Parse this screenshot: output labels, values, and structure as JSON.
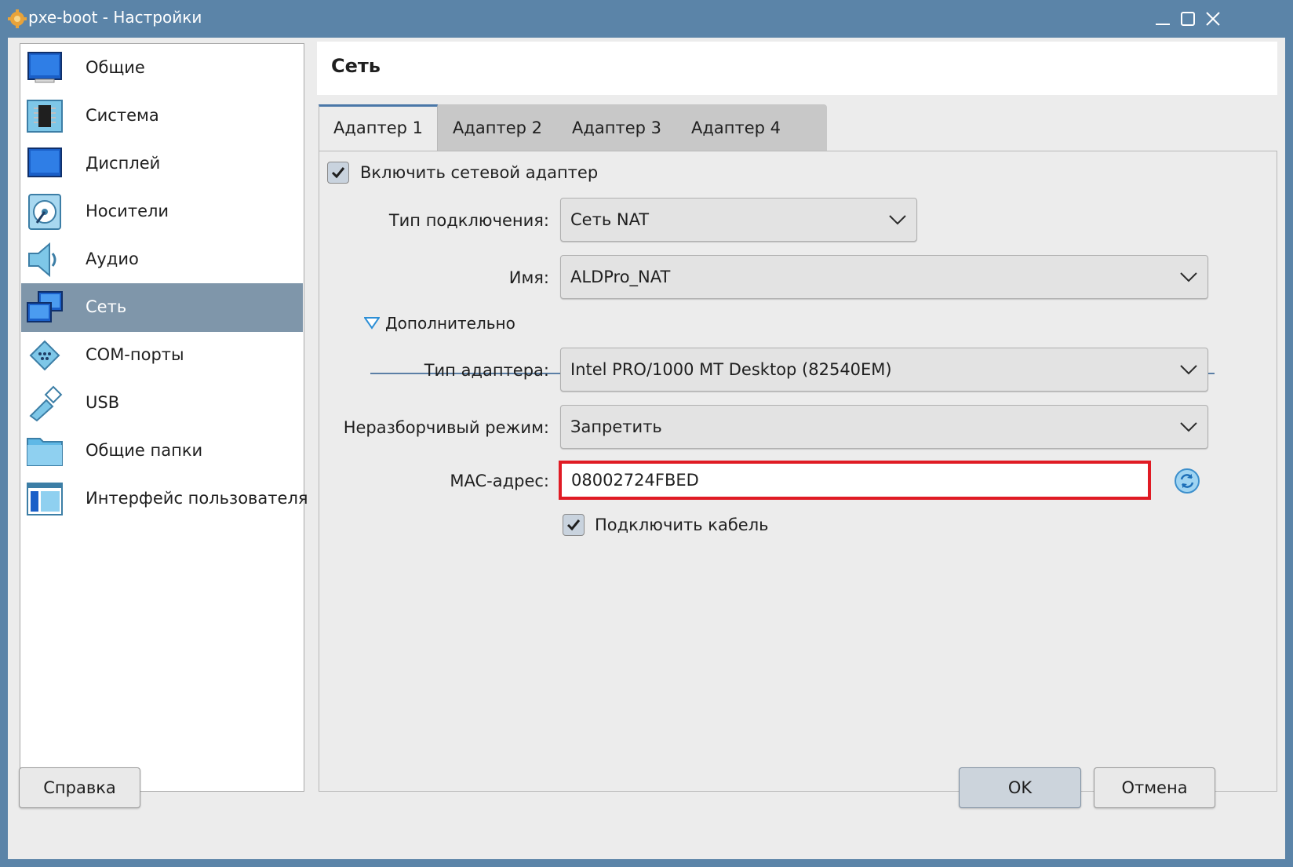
{
  "window": {
    "title": "pxe-boot - Настройки"
  },
  "sidebar": {
    "items": [
      {
        "label": "Общие",
        "icon": "general-monitor-icon"
      },
      {
        "label": "Система",
        "icon": "system-chip-icon"
      },
      {
        "label": "Дисплей",
        "icon": "display-monitor-icon"
      },
      {
        "label": "Носители",
        "icon": "storage-disk-icon"
      },
      {
        "label": "Аудио",
        "icon": "audio-speaker-icon"
      },
      {
        "label": "Сеть",
        "icon": "network-icon",
        "selected": true
      },
      {
        "label": "COM-порты",
        "icon": "serial-port-icon"
      },
      {
        "label": "USB",
        "icon": "usb-icon"
      },
      {
        "label": "Общие папки",
        "icon": "shared-folder-icon"
      },
      {
        "label": "Интерфейс пользователя",
        "icon": "user-interface-icon"
      }
    ]
  },
  "page": {
    "title": "Сеть"
  },
  "tabs": [
    {
      "label": "Адаптер 1",
      "active": true
    },
    {
      "label": "Адаптер 2"
    },
    {
      "label": "Адаптер 3"
    },
    {
      "label": "Адаптер 4"
    }
  ],
  "form": {
    "enable_adapter": {
      "label": "Включить сетевой адаптер",
      "checked": true
    },
    "attached_to": {
      "label": "Тип подключения:",
      "value": "Сеть NAT"
    },
    "name": {
      "label": "Имя:",
      "value": "ALDPro_NAT"
    },
    "advanced": {
      "label": "Дополнительно",
      "expanded": true
    },
    "adapter_type": {
      "label": "Тип адаптера:",
      "value": "Intel PRO/1000 MT Desktop (82540EM)"
    },
    "promiscuous": {
      "label": "Неразборчивый режим:",
      "value": "Запретить"
    },
    "mac": {
      "label": "MAC-адрес:",
      "value": "08002724FBED"
    },
    "cable": {
      "label": "Подключить кабель",
      "checked": true
    }
  },
  "buttons": {
    "help": "Справка",
    "ok": "OK",
    "cancel": "Отмена"
  },
  "colors": {
    "titlebar": "#5b84a8",
    "selection": "#7f96aa",
    "accent": "#4a77a8",
    "highlight_border": "#e01b24"
  }
}
